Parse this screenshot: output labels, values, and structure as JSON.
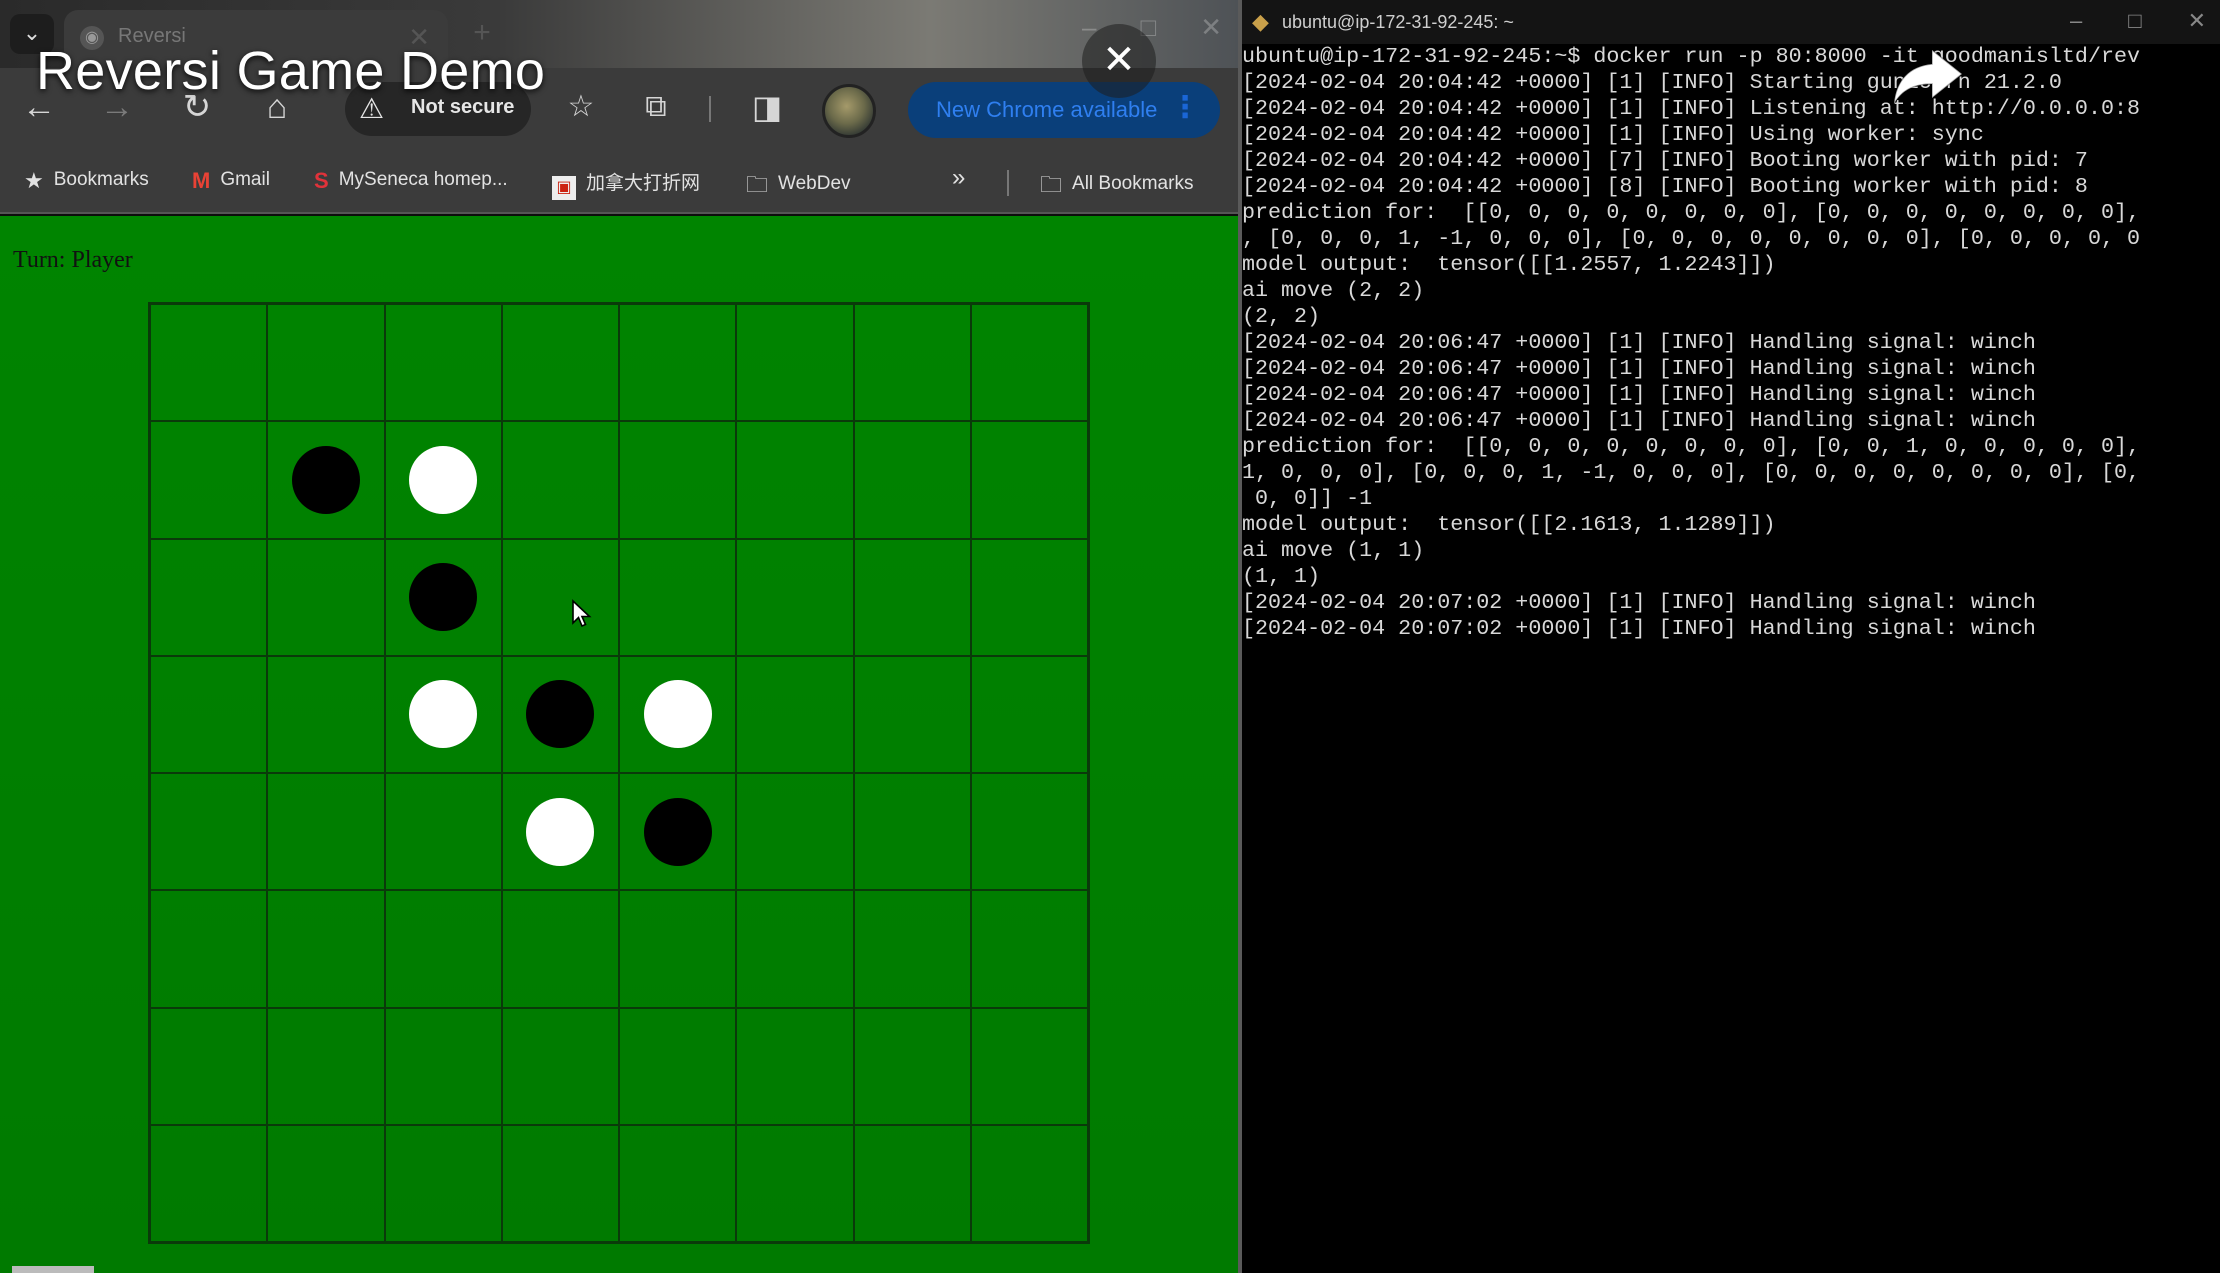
{
  "video": {
    "title": "Reversi Game Demo",
    "close_glyph": "✕"
  },
  "browser": {
    "tab": {
      "title": "Reversi"
    },
    "tab_list_glyph": "⌄",
    "tab_close_glyph": "✕",
    "new_tab_glyph": "+",
    "address": {
      "security_label": "Not secure"
    },
    "update_button": {
      "label": "New Chrome available",
      "menu_glyph": "⋮"
    },
    "bookmarks": [
      {
        "label": "Bookmarks",
        "icon": "star-icon"
      },
      {
        "label": "Gmail",
        "icon": "gmail-icon"
      },
      {
        "label": "MySeneca homep...",
        "icon": "seneca-icon"
      },
      {
        "label": "加拿大打折网",
        "icon": "site-favicon"
      },
      {
        "label": "WebDev",
        "icon": "folder-icon"
      }
    ],
    "bookmarks_overflow": "»",
    "all_bookmarks": "All Bookmarks"
  },
  "game": {
    "turn_text": "Turn: Player",
    "board": [
      [
        0,
        0,
        0,
        0,
        0,
        0,
        0,
        0
      ],
      [
        0,
        1,
        -1,
        0,
        0,
        0,
        0,
        0
      ],
      [
        0,
        0,
        1,
        0,
        0,
        0,
        0,
        0
      ],
      [
        0,
        0,
        -1,
        1,
        -1,
        0,
        0,
        0
      ],
      [
        0,
        0,
        0,
        -1,
        1,
        0,
        0,
        0
      ],
      [
        0,
        0,
        0,
        0,
        0,
        0,
        0,
        0
      ],
      [
        0,
        0,
        0,
        0,
        0,
        0,
        0,
        0
      ],
      [
        0,
        0,
        0,
        0,
        0,
        0,
        0,
        0
      ]
    ],
    "legend": {
      "1": "black",
      "-1": "white",
      "0": "empty"
    }
  },
  "terminal": {
    "title": "ubuntu@ip-172-31-92-245: ~",
    "lines": [
      "ubuntu@ip-172-31-92-245:~$ docker run -p 80:8000 -it goodmanisltd/rev",
      "[2024-02-04 20:04:42 +0000] [1] [INFO] Starting gunicorn 21.2.0",
      "[2024-02-04 20:04:42 +0000] [1] [INFO] Listening at: http://0.0.0.0:8",
      "[2024-02-04 20:04:42 +0000] [1] [INFO] Using worker: sync",
      "[2024-02-04 20:04:42 +0000] [7] [INFO] Booting worker with pid: 7",
      "[2024-02-04 20:04:42 +0000] [8] [INFO] Booting worker with pid: 8",
      "prediction for:  [[0, 0, 0, 0, 0, 0, 0, 0], [0, 0, 0, 0, 0, 0, 0, 0],",
      ", [0, 0, 0, 1, -1, 0, 0, 0], [0, 0, 0, 0, 0, 0, 0, 0], [0, 0, 0, 0, 0",
      "model output:  tensor([[1.2557, 1.2243]])",
      "ai move (2, 2)",
      "(2, 2)",
      "[2024-02-04 20:06:47 +0000] [1] [INFO] Handling signal: winch",
      "[2024-02-04 20:06:47 +0000] [1] [INFO] Handling signal: winch",
      "[2024-02-04 20:06:47 +0000] [1] [INFO] Handling signal: winch",
      "[2024-02-04 20:06:47 +0000] [1] [INFO] Handling signal: winch",
      "prediction for:  [[0, 0, 0, 0, 0, 0, 0, 0], [0, 0, 1, 0, 0, 0, 0, 0],",
      "1, 0, 0, 0], [0, 0, 0, 1, -1, 0, 0, 0], [0, 0, 0, 0, 0, 0, 0, 0], [0,",
      " 0, 0]] -1",
      "model output:  tensor([[2.1613, 1.1289]])",
      "ai move (1, 1)",
      "(1, 1)",
      "[2024-02-04 20:07:02 +0000] [1] [INFO] Handling signal: winch",
      "[2024-02-04 20:07:02 +0000] [1] [INFO] Handling signal: winch"
    ]
  }
}
